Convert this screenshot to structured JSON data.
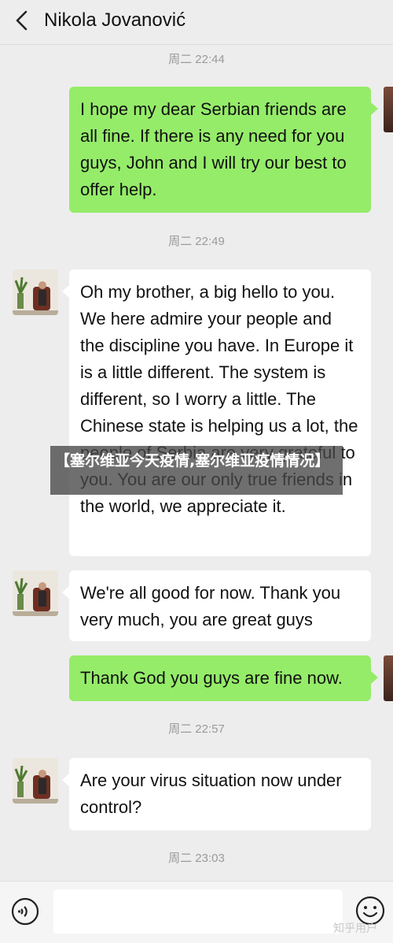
{
  "header": {
    "title": "Nikola Jovanović",
    "back_icon": "chevron-left-icon"
  },
  "messages": [
    {
      "type": "time",
      "text": "周二 22:44"
    },
    {
      "type": "out",
      "text": "I hope my dear Serbian friends are all fine. If there is any need for you guys, John and I will try our best to offer help."
    },
    {
      "type": "time",
      "text": "周二 22:49"
    },
    {
      "type": "in",
      "text": "Oh my brother, a big hello to you. We here admire your people and the discipline you have. In Europe it is a little different. The system is different, so I worry a little. The Chinese state is helping us a lot, the people of Serbia are very grateful to you. You are our only true friends in the world, we appreciate it."
    },
    {
      "type": "in",
      "text": "We're all good for now. Thank you very much, you are great guys"
    },
    {
      "type": "out",
      "text": "Thank God you guys are fine now."
    },
    {
      "type": "time",
      "text": "周二 22:57"
    },
    {
      "type": "in",
      "text": "Are your virus situation now under control?"
    },
    {
      "type": "time",
      "text": "周二 23:03"
    }
  ],
  "overlay": {
    "text": "【塞尔维亚今天疫情,塞尔维亚疫情情况】"
  },
  "footer": {
    "voice_icon": "voice-icon",
    "emoji_icon": "emoji-icon",
    "input_value": ""
  },
  "watermark": "知乎用户",
  "colors": {
    "background": "#ededed",
    "outgoing_bubble": "#95ec69",
    "incoming_bubble": "#ffffff",
    "timestamp": "#9a9a9a"
  }
}
